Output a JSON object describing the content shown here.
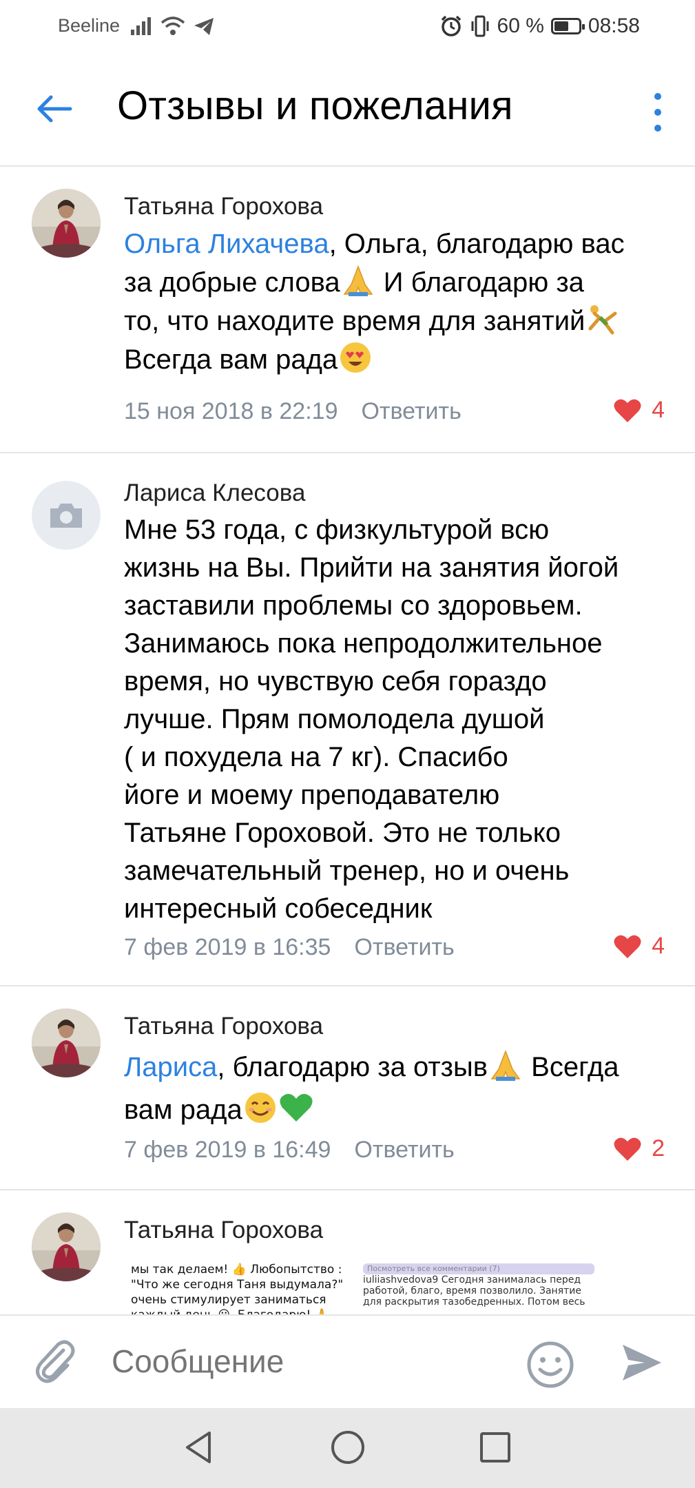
{
  "status_bar": {
    "carrier": "Beeline",
    "battery": "60 %",
    "battery_level": 0.6,
    "time": "08:58"
  },
  "header": {
    "title": "Отзывы и пожелания"
  },
  "comments": [
    {
      "author": "Татьяна Горохова",
      "mention": "Ольга Лихачева",
      "text_l1": ", Ольга, благодарю вас",
      "text_l2": "за добрые слова",
      "text_l2b": " И благодарю за",
      "text_l3": "то, что находите время для занятий",
      "text_l4": "Всегда вам рада",
      "date": "15 ноя 2018 в 22:19",
      "reply": "Ответить",
      "likes": "4"
    },
    {
      "author": "Лариса Клесова",
      "lines": [
        "Мне 53 года, с физкультурой всю",
        "жизнь на Вы. Прийти на занятия йогой",
        "заставили проблемы со здоровьем.",
        "Занимаюсь пока непродолжительное",
        "время, но чувствую себя гораздо",
        "лучше. Прям помолодела душой",
        "( и похудела на 7 кг). Спасибо",
        "йоге и моему преподавателю",
        "Татьяне Гороховой. Это не только",
        "замечательный тренер, но и очень",
        "интересный собеседник"
      ],
      "date": "7 фев 2019 в 16:35",
      "reply": "Ответить",
      "likes": "4"
    },
    {
      "author": "Татьяна Горохова",
      "mention": "Лариса",
      "text_l1": ", благодарю за отзыв",
      "text_l1b": " Всегда",
      "text_l2": "вам рада",
      "date": "7 фев 2019 в 16:49",
      "reply": "Ответить",
      "likes": "2"
    },
    {
      "author": "Татьяна Горохова",
      "attachment_left": [
        "мы так делаем! 👍 Любопытство :",
        "\"Что же сегодня Таня выдумала?\"",
        "очень стимулирует заниматься",
        "каждый день 😃. Благодарю! 🙏"
      ],
      "attachment_right_bar": "Посмотреть все комментарии (7)",
      "attachment_right": [
        "iuliiashvedova9 Сегодня занималась перед",
        "работой, благо, время позволило. Занятие",
        "для раскрытия тазобедренных. Потом весь"
      ]
    }
  ],
  "composer": {
    "placeholder": "Сообщение"
  },
  "icons": {
    "back": "arrow-left-icon",
    "menu": "more-vertical-icon",
    "like": "heart-icon",
    "attach": "paperclip-icon",
    "emoji": "smile-icon",
    "send": "send-icon"
  },
  "colors": {
    "accent": "#2d81e0",
    "meta": "#818c99",
    "like": "#e64646",
    "divider": "#e5e5e5"
  }
}
